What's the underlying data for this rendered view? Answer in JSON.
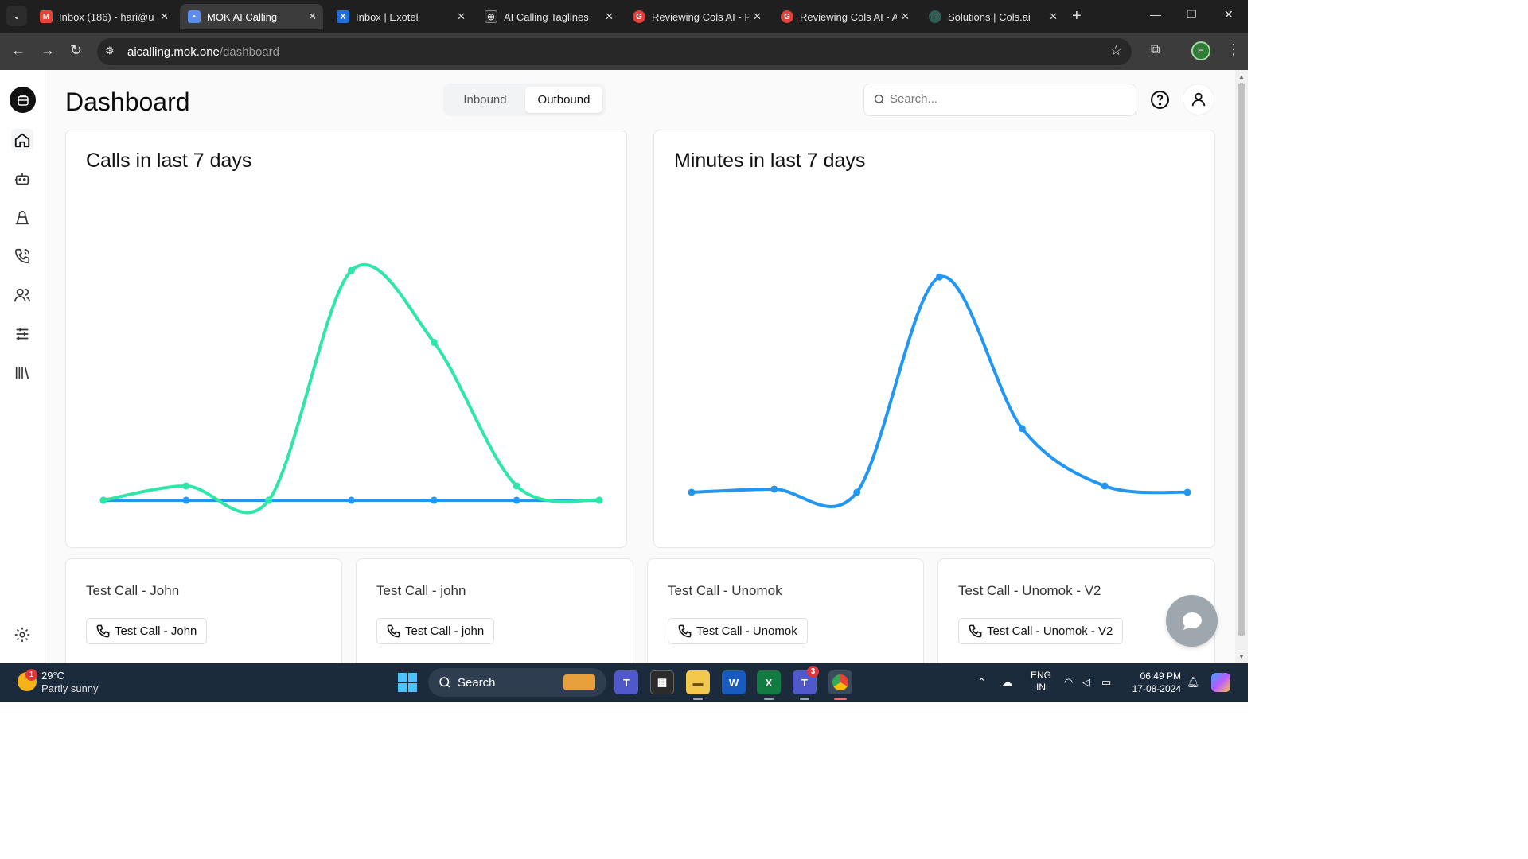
{
  "browser": {
    "tabs": [
      {
        "title": "Inbox (186) - hari@u",
        "icon": "gmail-icon",
        "color": "#ea4335",
        "letter": "M"
      },
      {
        "title": "MOK AI Calling",
        "icon": "mok-icon",
        "color": "#5b8def",
        "letter": "•"
      },
      {
        "title": "Inbox | Exotel",
        "icon": "exotel-icon",
        "color": "#1e6fd9",
        "letter": "X"
      },
      {
        "title": "AI Calling Taglines",
        "icon": "chatgpt-icon",
        "color": "#2b2b2b",
        "letter": "◎"
      },
      {
        "title": "Reviewing Cols AI - P",
        "icon": "grammarly-icon",
        "color": "#e0413a",
        "letter": "G"
      },
      {
        "title": "Reviewing Cols AI - A",
        "icon": "grammarly-icon",
        "color": "#e0413a",
        "letter": "G"
      },
      {
        "title": "Solutions | Cols.ai",
        "icon": "colsai-icon",
        "color": "#2f5d55",
        "letter": "—"
      }
    ],
    "url_host": "aicalling.mok.one",
    "url_path": "/dashboard",
    "profile_initial": "H"
  },
  "header": {
    "title": "Dashboard",
    "toggle_inbound": "Inbound",
    "toggle_outbound": "Outbound",
    "search_placeholder": "Search..."
  },
  "charts": {
    "calls_title": "Calls in last 7 days",
    "minutes_title": "Minutes in last 7 days"
  },
  "chart_data": [
    {
      "type": "line",
      "title": "Calls in last 7 days",
      "x": [
        1,
        2,
        3,
        4,
        5,
        6,
        7
      ],
      "ylim": [
        0,
        20
      ],
      "series": [
        {
          "color": "#2ee6a6",
          "values": [
            0,
            1,
            0,
            16,
            11,
            1,
            0
          ]
        },
        {
          "color": "#2196f3",
          "values": [
            0,
            0,
            0,
            0,
            0,
            0,
            0
          ]
        }
      ]
    },
    {
      "type": "line",
      "title": "Minutes in last 7 days",
      "x": [
        1,
        2,
        3,
        4,
        5,
        6,
        7
      ],
      "ylim": [
        0,
        18
      ],
      "series": [
        {
          "color": "#2196f3",
          "values": [
            0.5,
            0.7,
            0.5,
            14,
            4.5,
            0.9,
            0.5
          ]
        }
      ]
    }
  ],
  "call_cards": [
    {
      "title": "Test Call - John",
      "button": "Test Call - John"
    },
    {
      "title": "Test Call - john",
      "button": "Test Call - john"
    },
    {
      "title": "Test Call - Unomok",
      "button": "Test Call - Unomok"
    },
    {
      "title": "Test Call - Unomok - V2",
      "button": "Test Call - Unomok - V2"
    }
  ],
  "taskbar": {
    "temperature": "29°C",
    "weather": "Partly sunny",
    "weather_badge": "1",
    "search_label": "Search",
    "teams_badge": "3",
    "lang_line1": "ENG",
    "lang_line2": "IN",
    "time": "06:49 PM",
    "date": "17-08-2024"
  }
}
